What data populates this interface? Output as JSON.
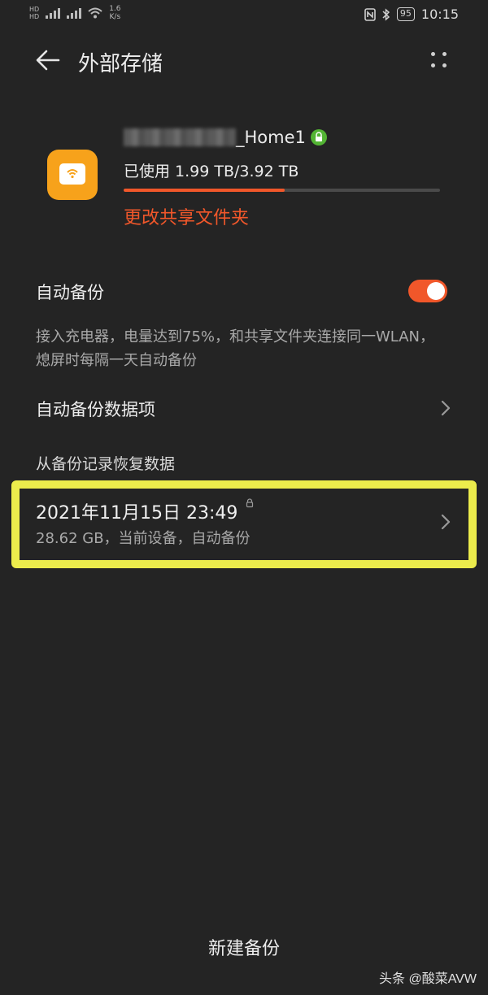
{
  "status_bar": {
    "badge_top": "HD",
    "badge_bottom": "HD",
    "network": "4G",
    "speed_value": "1.6",
    "speed_unit": "K/s",
    "battery": "95",
    "time": "10:15"
  },
  "header": {
    "title": "外部存储"
  },
  "storage": {
    "device_name_suffix": "_Home1",
    "usage_label": "已使用 1.99 TB/3.92 TB",
    "usage_fraction": 0.508,
    "change_folder_link": "更改共享文件夹"
  },
  "auto_backup": {
    "title": "自动备份",
    "enabled": true,
    "description": "接入充电器，电量达到75%，和共享文件夹连接同一WLAN，熄屏时每隔一天自动备份"
  },
  "backup_items": {
    "title": "自动备份数据项"
  },
  "restore": {
    "section_title": "从备份记录恢复数据",
    "records": [
      {
        "date": "2021年11月15日 23:49",
        "meta": "28.62 GB，当前设备，自动备份"
      }
    ]
  },
  "actions": {
    "new_backup": "新建备份"
  },
  "watermark": "头条 @酸菜AVW",
  "colors": {
    "accent": "#f1572a",
    "highlight_border": "#ecec4c",
    "background": "#242424",
    "storage_icon": "#f7a21b",
    "lock_green": "#53b434"
  }
}
